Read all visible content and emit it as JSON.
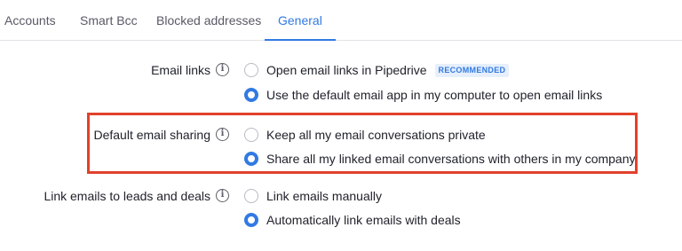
{
  "tabs": [
    {
      "label": "Accounts",
      "active": false
    },
    {
      "label": "Smart Bcc",
      "active": false
    },
    {
      "label": "Blocked addresses",
      "active": false
    },
    {
      "label": "General",
      "active": true
    }
  ],
  "settings": [
    {
      "label": "Email links",
      "info_icon": "info-icon",
      "options": [
        {
          "text": "Open email links in Pipedrive",
          "badge": "RECOMMENDED",
          "selected": false
        },
        {
          "text": "Use the default email app in my computer to open email links",
          "selected": true
        }
      ]
    },
    {
      "label": "Default email sharing",
      "info_icon": "info-icon",
      "highlighted": true,
      "options": [
        {
          "text": "Keep all my email conversations private",
          "selected": false
        },
        {
          "text": "Share all my linked email conversations with others in my company",
          "selected": true
        }
      ]
    },
    {
      "label": "Link emails to leads and deals",
      "info_icon": "info-icon",
      "options": [
        {
          "text": "Link emails manually",
          "selected": false
        },
        {
          "text": "Automatically link emails with deals",
          "selected": true
        }
      ]
    }
  ],
  "colors": {
    "accent": "#317ae2",
    "highlight_border": "#e1412b",
    "badge_bg": "#e6effb"
  }
}
